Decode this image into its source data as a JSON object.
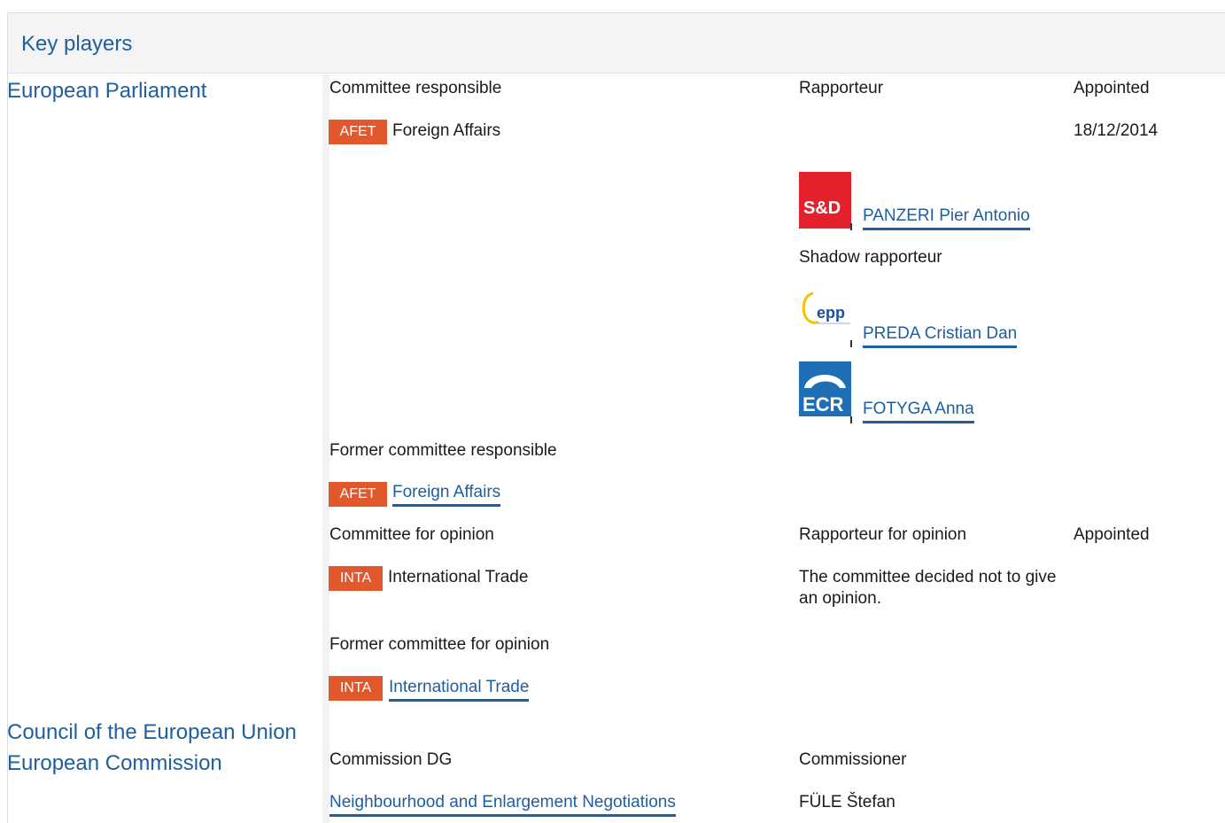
{
  "section_title": "Key players",
  "institutions": {
    "ep": "European Parliament",
    "council": "Council of the European Union",
    "commission": "European Commission"
  },
  "ep": {
    "col_committee_responsible": "Committee responsible",
    "col_rapporteur": "Rapporteur",
    "col_appointed": "Appointed",
    "afet_badge": "AFET",
    "afet_name": "Foreign Affairs",
    "afet_appointed": "18/12/2014",
    "rapporteur": {
      "group_logo": "S&D",
      "name": "PANZERI Pier Antonio"
    },
    "shadow_label": "Shadow rapporteur",
    "shadows": [
      {
        "group_logo": "epp",
        "name": "PREDA Cristian Dan"
      },
      {
        "group_logo": "ECR",
        "name": "FOTYGA Anna"
      }
    ],
    "former_responsible_label": "Former committee responsible",
    "former_afet_badge": "AFET",
    "former_afet_name": "Foreign Affairs",
    "col_committee_opinion": "Committee for opinion",
    "col_rapporteur_opinion": "Rapporteur for opinion",
    "col_appointed_opinion": "Appointed",
    "inta_badge": "INTA",
    "inta_name": "International Trade",
    "inta_note": "The committee decided not to give an opinion.",
    "former_opinion_label": "Former committee for opinion",
    "former_inta_badge": "INTA",
    "former_inta_name": "International Trade"
  },
  "commission": {
    "col_dg": "Commission DG",
    "col_commissioner": "Commissioner",
    "dg_name": "Neighbourhood and Enlargement Negotiations",
    "commissioner_name": "FÜLE Štefan"
  },
  "colors": {
    "accent": "#1e5fa0",
    "badge": "#e0582b",
    "sd": "#e3212d",
    "ecr": "#1e6fb5"
  }
}
